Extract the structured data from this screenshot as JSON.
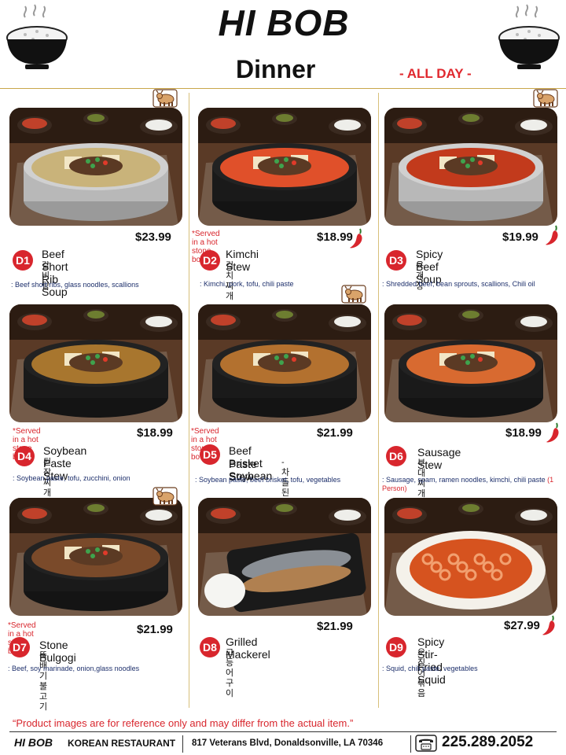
{
  "brand": {
    "logo_text": "HI BOB"
  },
  "header": {
    "title": "Dinner",
    "subtitle": "- ALL DAY -"
  },
  "items": [
    {
      "code": "D1",
      "price": "$23.99",
      "english": "Beef Short Rib Soup",
      "korean": "갈비탕",
      "desc": ": Beef short ribs, glass noodles, scallions",
      "note": "",
      "beef": true,
      "spicy": false
    },
    {
      "code": "D2",
      "price": "$18.99",
      "english": "Kimchi Stew",
      "korean": "김치찌개",
      "desc": ": Kimchi, pork, tofu, chili paste",
      "note": "*Served in a hot stone bowl",
      "beef": false,
      "spicy": true
    },
    {
      "code": "D3",
      "price": "$19.99",
      "english": "Spicy Beef Soup",
      "korean": "육개장",
      "desc": ": Shredded beef, bean sprouts, scallions, Chili oil",
      "note": "",
      "beef": true,
      "spicy": true
    },
    {
      "code": "D4",
      "price": "$18.99",
      "english": "Soybean Paste Stew",
      "korean": "된장찌개",
      "desc": ": Soybean paste, tofu, zucchini, onion",
      "note": "*Served in a hot stone bowl",
      "beef": false,
      "spicy": false
    },
    {
      "code": "D5",
      "price": "$21.99",
      "english": "Beef Brisket Soybean",
      "english2": "Paste Stew",
      "korean": " - 차돌 된장찌개",
      "desc": ": Soybean paste, beef brisket, tofu, vegetables",
      "note": "*Served in a hot stone bowl",
      "beef": true,
      "spicy": false
    },
    {
      "code": "D6",
      "price": "$18.99",
      "english": "Sausage Stew",
      "korean": "부대찌개",
      "desc": ": Sausage, spam, ramen noodles, kimchi, chili paste",
      "desc_extra": " (1 Person)",
      "note": "",
      "beef": false,
      "spicy": true
    },
    {
      "code": "D7",
      "price": "$21.99",
      "english": "Stone  Bulgogi",
      "korean": "뚝배기 불고기",
      "desc": ": Beef, soy marinade, onion,glass noodles",
      "note": "*Served in a hot stone bowl",
      "beef": true,
      "spicy": false
    },
    {
      "code": "D8",
      "price": "$21.99",
      "english": "Grilled Mackerel",
      "korean": "고등어 구이",
      "desc": "",
      "note": "",
      "beef": false,
      "spicy": false
    },
    {
      "code": "D9",
      "price": "$27.99",
      "english": "Spicy Stir-Fried Squid",
      "korean": "오징어볶음",
      "desc": ": Squid, chili paste, vegetables",
      "note": "",
      "beef": false,
      "spicy": true
    }
  ],
  "footer": {
    "disclaimer": "“Product images are for reference only and may differ from the actual item.”",
    "logo": "HI BOB",
    "restaurant": "KOREAN RESTAURANT",
    "address": "817 Veterans Blvd, Donaldsonville, LA 70346",
    "phone": "225.289.2052"
  },
  "colors": {
    "accent_red": "#d8262d",
    "desc_navy": "#1d2f6b",
    "divider_gold": "#c9a64a"
  }
}
